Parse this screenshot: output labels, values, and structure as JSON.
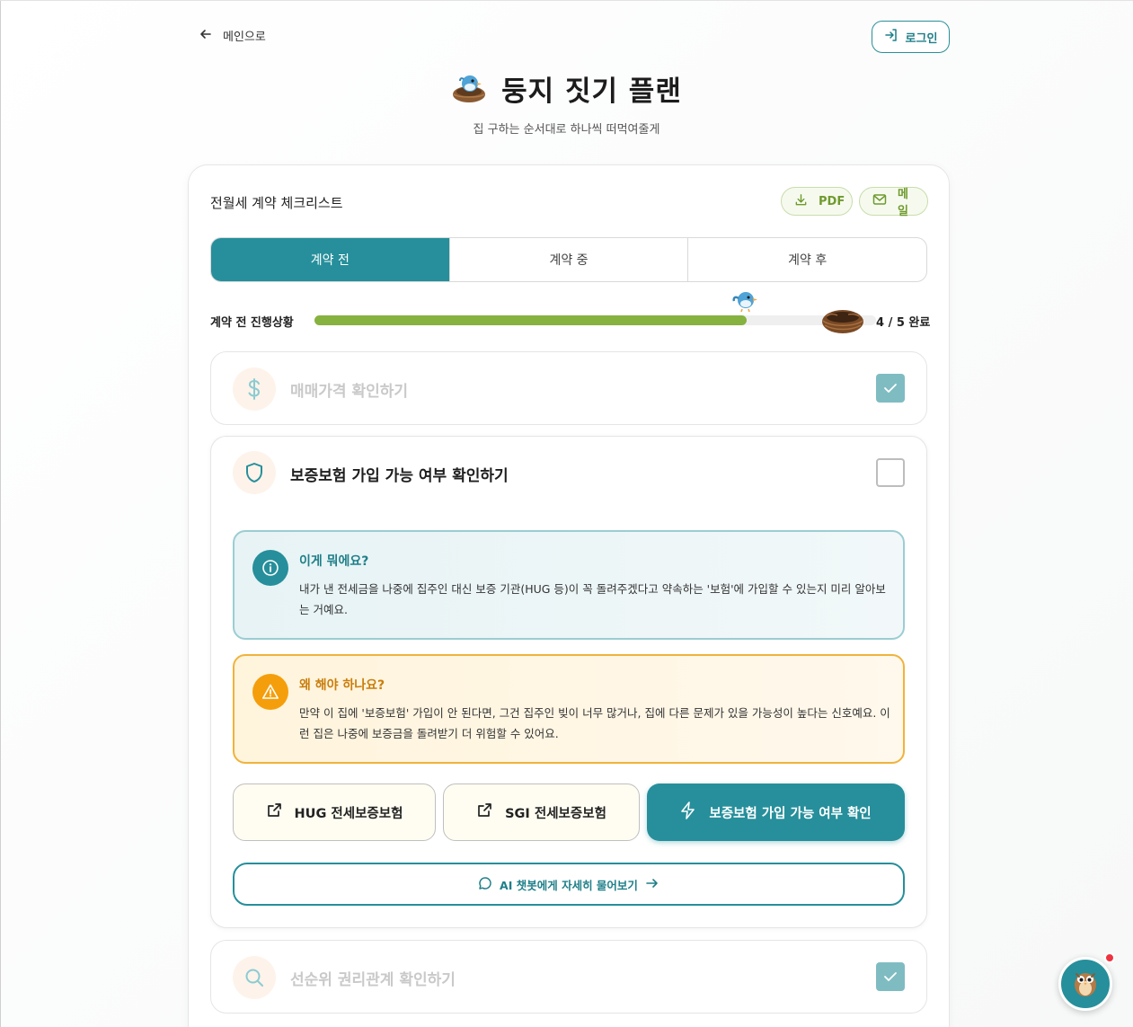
{
  "nav": {
    "back_label": "메인으로",
    "login_label": "로그인"
  },
  "header": {
    "title": "둥지 짓기 플랜",
    "subtitle": "집 구하는 순서대로 하나씩 떠먹여줄게"
  },
  "card": {
    "title": "전월세 계약 체크리스트",
    "pdf_label": "PDF",
    "mail_label": "메일",
    "tabs": [
      {
        "label": "계약 전",
        "active": true
      },
      {
        "label": "계약 중",
        "active": false
      },
      {
        "label": "계약 후",
        "active": false
      }
    ],
    "progress": {
      "label": "계약 전 진행상황",
      "done": 4,
      "total": 5,
      "count_text": "4 / 5 완료",
      "fill_fraction": 0.77
    },
    "items": [
      {
        "title": "매매가격 확인하기",
        "icon": "dollar-icon",
        "checked": true
      },
      {
        "title": "보증보험 가입 가능 여부 확인하기",
        "icon": "shield-icon",
        "checked": false,
        "info": {
          "title": "이게 뭐에요?",
          "text": "내가 낸 전세금을 나중에 집주인 대신 보증 기관(HUG 등)이 꼭 돌려주겠다고 약속하는 '보험'에 가입할 수 있는지 미리 알아보는 거예요."
        },
        "warning": {
          "title": "왜 해야 하나요?",
          "text": "만약 이 집에 '보증보험' 가입이 안 된다면, 그건 집주인 빚이 너무 많거나, 집에 다른 문제가 있을 가능성이 높다는 신호예요. 이런 집은 나중에 보증금을 돌려받기 더 위험할 수 있어요."
        },
        "buttons": {
          "hug": "HUG 전세보증보험",
          "sgi": "SGI 전세보증보험",
          "check": "보증보험 가입 가능 여부 확인"
        },
        "ai_label": "AI 챗봇에게 자세히 물어보기"
      },
      {
        "title": "선순위 권리관계 확인하기",
        "icon": "search-icon",
        "checked": true
      }
    ]
  },
  "colors": {
    "primary": "#268f9b",
    "progress": "#86b23f",
    "warning": "#f59e0b",
    "accent_green": "#6f9a2e",
    "notification": "#ef3340"
  }
}
